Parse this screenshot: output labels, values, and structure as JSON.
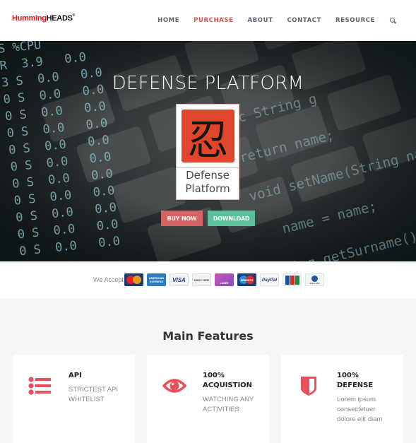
{
  "header": {
    "logo": {
      "part1": "Humming",
      "part2": "HEADS",
      "mark": "®"
    },
    "nav": [
      {
        "label": "HOME",
        "active": false
      },
      {
        "label": "PURCHASE",
        "active": true
      },
      {
        "label": "ABOUT",
        "active": false
      },
      {
        "label": "CONTACT",
        "active": false
      },
      {
        "label": "RESOURCE",
        "active": false
      }
    ],
    "search_icon": "search-icon"
  },
  "hero": {
    "title": "DEFENSE PLATFORM",
    "product_logo": {
      "kanji": "忍",
      "line1": "Defense",
      "line2": "Platform"
    },
    "buy_label": "BUY NOW",
    "download_label": "DOWNLOAD",
    "background_code_left": "S %CPU\nR  3.9   0.0\n3 S  0.0   0.0\n0 S  0.0   0.0\n0 S  0.0   0.0\n0 S  0.0   0.0\n0 S  0.0   0.0\n0 S  0.0   0.0\n0 S  0.0   0.0\n0 S  0.0   0.0\n0 S  0.0   0.0\n0 S  0.0   0.0\n0 S  0.0   0.0",
    "background_code_right": "ic String g\nreturn name;\nvoid setName(String name) {\n   name = name;\nString getSurname() {\n   surname;\nvoid setSurname(String\nthis.surname = surname;\nString getTitle() {"
  },
  "payments": {
    "label": "We Accept",
    "cards": [
      "MasterCard",
      "American Express",
      "VISA",
      "DISCOVER",
      "LASER",
      "Maestro",
      "PayPal",
      "JCB",
      "Diners Club International"
    ]
  },
  "features": {
    "title": "Main Features",
    "items": [
      {
        "icon": "list-icon",
        "title_line1": "API",
        "title_line2": "",
        "desc_line1": "STRICTEST API",
        "desc_line2": "WHITELIST",
        "desc_line3": ""
      },
      {
        "icon": "eye-icon",
        "title_line1": "100%",
        "title_line2": "ACQUISTION",
        "desc_line1": "WATCHING ANY",
        "desc_line2": "ACTIVITIES",
        "desc_line3": ""
      },
      {
        "icon": "shield-icon",
        "title_line1": "100%",
        "title_line2": "DEFENSE",
        "desc_line1": "Lorem ipsum",
        "desc_line2": "consectetuer",
        "desc_line3": "dolore elit diam"
      }
    ]
  },
  "colors": {
    "accent_red": "#d9534f",
    "buy_button": "#d46464",
    "download_button": "#5bbf99",
    "feature_icon": "#e8505b",
    "logo_red": "#e5141d"
  }
}
